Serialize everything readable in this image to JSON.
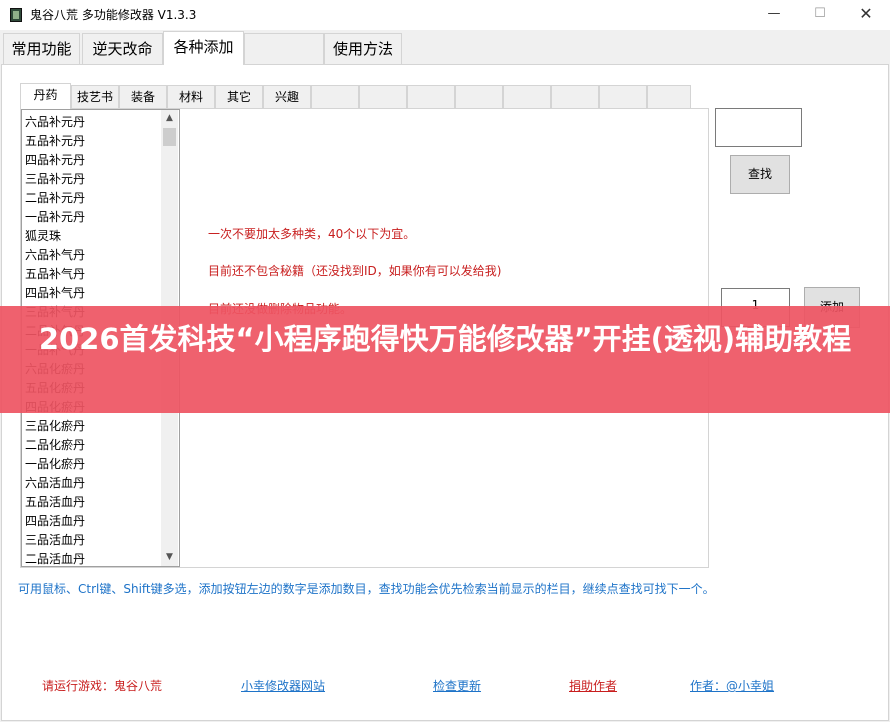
{
  "window": {
    "title": "鬼谷八荒 多功能修改器  V1.3.3",
    "minimize_glyph": "—",
    "maximize_glyph": "☐",
    "close_glyph": "✕"
  },
  "main_tabs": [
    {
      "label": "常用功能"
    },
    {
      "label": "逆天改命"
    },
    {
      "label": "各种添加"
    },
    {
      "label": "使用方法"
    }
  ],
  "main_tabs_active": "各种添加",
  "sub_tabs": [
    {
      "label": "丹药"
    },
    {
      "label": "技艺书"
    },
    {
      "label": "装备"
    },
    {
      "label": "材料"
    },
    {
      "label": "其它"
    },
    {
      "label": "兴趣"
    }
  ],
  "sub_tabs_active": "丹药",
  "item_list": [
    "六品补元丹",
    "五品补元丹",
    "四品补元丹",
    "三品补元丹",
    "二品补元丹",
    "一品补元丹",
    "狐灵珠",
    "六品补气丹",
    "五品补气丹",
    "四品补气丹",
    "三品补气丹",
    "二品补气丹",
    "一品补气丹",
    "六品化瘀丹",
    "五品化瘀丹",
    "四品化瘀丹",
    "三品化瘀丹",
    "二品化瘀丹",
    "一品化瘀丹",
    "六品活血丹",
    "五品活血丹",
    "四品活血丹",
    "三品活血丹",
    "二品活血丹"
  ],
  "scrollbar": {
    "up_arrow": "▲",
    "down_arrow": "▼"
  },
  "notes": [
    "一次不要加太多种类，40个以下为宜。",
    "目前还不包含秘籍（还没找到ID，如果你有可以发给我)",
    "目前还没做删除物品功能。"
  ],
  "search": {
    "value": "",
    "button_label": "查找"
  },
  "add": {
    "quantity": "1",
    "button_label": "添加"
  },
  "hint": "可用鼠标、Ctrl键、Shift键多选，添加按钮左边的数字是添加数目，查找功能会优先检索当前显示的栏目，继续点查找可找下一个。",
  "footer": {
    "game_prompt": "请运行游戏：鬼谷八荒",
    "website_link": "小幸修改器网站",
    "update_link": "检查更新",
    "donate_link": "捐助作者",
    "author_link": "作者：@小幸姐"
  },
  "overlay_banner": "2026首发科技“小程序跑得快万能修改器”开挂(透视)辅助教程",
  "colors": {
    "note_red": "#c81e1e",
    "hint_blue": "#1e73c8",
    "banner": "#ee5462"
  }
}
